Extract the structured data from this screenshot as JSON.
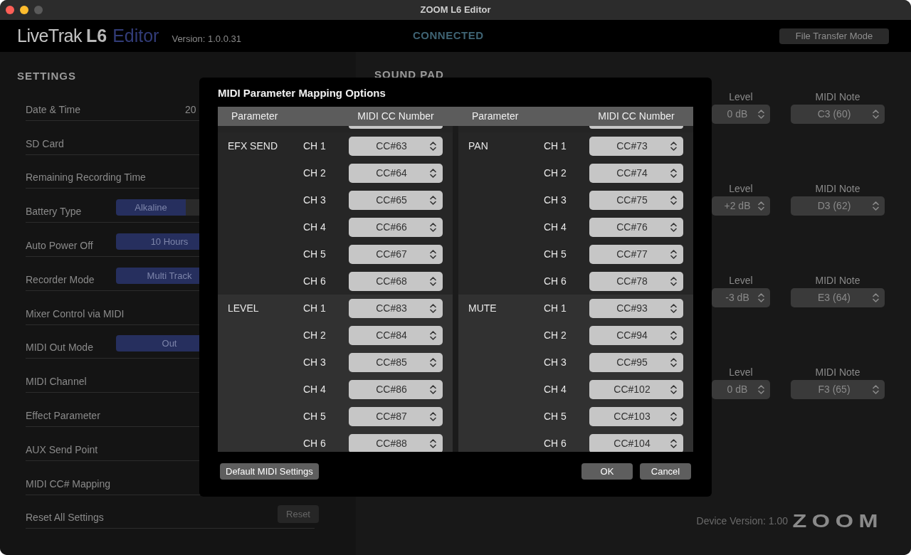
{
  "window": {
    "title": "ZOOM L6 Editor"
  },
  "header": {
    "brand": "LiveTrak",
    "model": "L6",
    "suffix": "Editor",
    "version": "Version: 1.0.0.31",
    "status": "CONNECTED",
    "file_transfer_button": "File Transfer Mode"
  },
  "settings": {
    "title": "SETTINGS",
    "rows": [
      {
        "label": "Date & Time",
        "kind": "text",
        "value": "20"
      },
      {
        "label": "SD Card",
        "kind": "none"
      },
      {
        "label": "Remaining Recording Time",
        "kind": "none"
      },
      {
        "label": "Battery Type",
        "kind": "segmented",
        "options": [
          {
            "label": "Alkaline",
            "selected": true
          },
          {
            "selected": false
          }
        ]
      },
      {
        "label": "Auto Power Off",
        "kind": "segmented",
        "options": [
          {
            "label": "10 Hours",
            "selected": true
          }
        ]
      },
      {
        "label": "Recorder Mode",
        "kind": "segmented",
        "options": [
          {
            "label": "Multi Track",
            "selected": true
          }
        ]
      },
      {
        "label": "Mixer Control via MIDI",
        "kind": "none"
      },
      {
        "label": "MIDI Out Mode",
        "kind": "segmented",
        "options": [
          {
            "label": "Out",
            "selected": true
          }
        ]
      },
      {
        "label": "MIDI Channel",
        "kind": "none"
      },
      {
        "label": "Effect Parameter",
        "kind": "none"
      },
      {
        "label": "AUX Send Point",
        "kind": "none"
      },
      {
        "label": "MIDI CC# Mapping",
        "kind": "none"
      },
      {
        "label": "Reset All Settings",
        "kind": "button",
        "value": "Reset"
      }
    ]
  },
  "sound_pad": {
    "title": "SOUND PAD",
    "pads": [
      {
        "level_label": "Level",
        "level": "0 dB",
        "note_label": "MIDI Note",
        "note": "C3 (60)"
      },
      {
        "level_label": "Level",
        "level": "+2 dB",
        "note_label": "MIDI Note",
        "note": "D3 (62)"
      },
      {
        "level_label": "Level",
        "level": "-3 dB",
        "note_label": "MIDI Note",
        "note": "E3 (64)"
      },
      {
        "level_label": "Level",
        "level": "0 dB",
        "note_label": "MIDI Note",
        "note": "F3 (65)"
      }
    ]
  },
  "footer": {
    "device_version": "Device Version: 1.00",
    "logo": "ZOOM"
  },
  "dialog": {
    "title": "MIDI Parameter Mapping Options",
    "columns": [
      {
        "parameter": "Parameter",
        "cc": "MIDI CC Number"
      },
      {
        "parameter": "Parameter",
        "cc": "MIDI CC Number"
      }
    ],
    "groups": [
      {
        "left": {
          "name": "EFX SEND",
          "rows": [
            {
              "channel": "CH 1",
              "value": "CC#63"
            },
            {
              "channel": "CH 2",
              "value": "CC#64"
            },
            {
              "channel": "CH 3",
              "value": "CC#65"
            },
            {
              "channel": "CH 4",
              "value": "CC#66"
            },
            {
              "channel": "CH 5",
              "value": "CC#67"
            },
            {
              "channel": "CH 6",
              "value": "CC#68"
            }
          ]
        },
        "right": {
          "name": "PAN",
          "rows": [
            {
              "channel": "CH 1",
              "value": "CC#73"
            },
            {
              "channel": "CH 2",
              "value": "CC#74"
            },
            {
              "channel": "CH 3",
              "value": "CC#75"
            },
            {
              "channel": "CH 4",
              "value": "CC#76"
            },
            {
              "channel": "CH 5",
              "value": "CC#77"
            },
            {
              "channel": "CH 6",
              "value": "CC#78"
            }
          ]
        }
      },
      {
        "left": {
          "name": "LEVEL",
          "rows": [
            {
              "channel": "CH 1",
              "value": "CC#83"
            },
            {
              "channel": "CH 2",
              "value": "CC#84"
            },
            {
              "channel": "CH 3",
              "value": "CC#85"
            },
            {
              "channel": "CH 4",
              "value": "CC#86"
            },
            {
              "channel": "CH 5",
              "value": "CC#87"
            },
            {
              "channel": "CH 6",
              "value": "CC#88"
            }
          ]
        },
        "right": {
          "name": "MUTE",
          "rows": [
            {
              "channel": "CH 1",
              "value": "CC#93"
            },
            {
              "channel": "CH 2",
              "value": "CC#94"
            },
            {
              "channel": "CH 3",
              "value": "CC#95"
            },
            {
              "channel": "CH 4",
              "value": "CC#102"
            },
            {
              "channel": "CH 5",
              "value": "CC#103"
            },
            {
              "channel": "CH 6",
              "value": "CC#104"
            }
          ]
        }
      }
    ],
    "default_button": "Default MIDI Settings",
    "ok_button": "OK",
    "cancel_button": "Cancel"
  }
}
